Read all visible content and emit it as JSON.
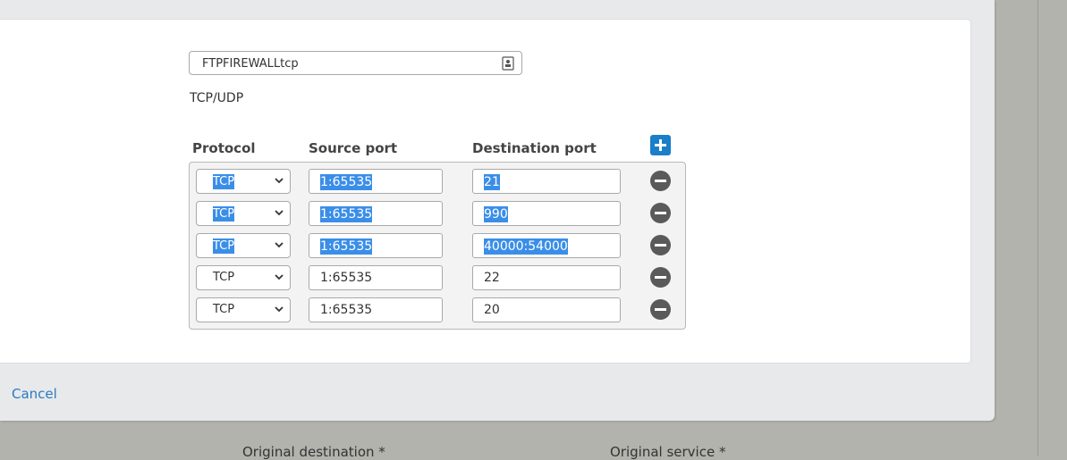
{
  "service": {
    "name_value": "FTPFIREWALLtcp",
    "type_label": "TCP/UDP"
  },
  "table": {
    "headers": {
      "protocol": "Protocol",
      "source_port": "Source port",
      "destination_port": "Destination port"
    },
    "rows": [
      {
        "protocol": "TCP",
        "source": "1:65535",
        "destination": "21",
        "selected": true
      },
      {
        "protocol": "TCP",
        "source": "1:65535",
        "destination": "990",
        "selected": true
      },
      {
        "protocol": "TCP",
        "source": "1:65535",
        "destination": "40000:54000",
        "selected": true
      },
      {
        "protocol": "TCP",
        "source": "1:65535",
        "destination": "22",
        "selected": false
      },
      {
        "protocol": "TCP",
        "source": "1:65535",
        "destination": "20",
        "selected": false
      }
    ]
  },
  "footer": {
    "cancel_label": "Cancel"
  },
  "background_form": {
    "original_destination_label": "Original destination *",
    "original_service_label": "Original service *"
  },
  "colors": {
    "accent": "#1b7ec8",
    "selection": "#3b8ee8",
    "link": "#2a7bc4"
  }
}
